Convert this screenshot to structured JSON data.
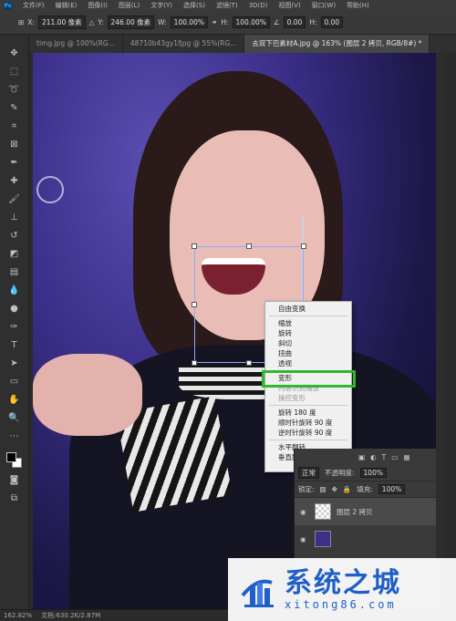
{
  "app": {
    "logo": "Ps"
  },
  "menu": [
    "文件(F)",
    "编辑(E)",
    "图像(I)",
    "图层(L)",
    "文字(Y)",
    "选择(S)",
    "滤镜(T)",
    "3D(D)",
    "视图(V)",
    "窗口(W)",
    "帮助(H)"
  ],
  "options": {
    "x_label": "X:",
    "x_value": "211.00 像素",
    "y_label": "Y:",
    "y_value": "246.00 像素",
    "w_label": "W:",
    "w_value": "100.00%",
    "h_label": "H:",
    "h_value": "100.00%",
    "angle_value": "0.00",
    "hskew_label": "H:",
    "hskew_value": "0.00"
  },
  "tabs": [
    {
      "label": "timg.jpg @ 100%(RG..."
    },
    {
      "label": "48710b43gy1fjpg @ 55%(RG..."
    },
    {
      "label": "去双下巴素材A.jpg @ 163% (图层 2 拷贝, RGB/8#) *"
    }
  ],
  "context_menu": {
    "items": [
      {
        "label": "自由变换",
        "disabled": false
      },
      {
        "sep": true
      },
      {
        "label": "缩放",
        "disabled": false
      },
      {
        "label": "旋转",
        "disabled": false
      },
      {
        "label": "斜切",
        "disabled": false
      },
      {
        "label": "扭曲",
        "disabled": false
      },
      {
        "label": "透视",
        "disabled": false
      },
      {
        "sep": true
      },
      {
        "label": "变形",
        "disabled": false
      },
      {
        "label": "内容识别缩放",
        "disabled": true
      },
      {
        "label": "操控变形",
        "disabled": true
      },
      {
        "sep": true
      },
      {
        "label": "旋转 180 度",
        "disabled": false
      },
      {
        "label": "顺时针旋转 90 度",
        "disabled": false
      },
      {
        "label": "逆时针旋转 90 度",
        "disabled": false
      },
      {
        "sep": true
      },
      {
        "label": "水平翻转",
        "disabled": false
      },
      {
        "label": "垂直翻转",
        "disabled": false
      }
    ],
    "highlight_color": "#2eb82e"
  },
  "layers_panel": {
    "blend_mode": "正常",
    "opacity_label": "不透明度:",
    "opacity_value": "100%",
    "lock_label": "锁定:",
    "fill_label": "填充:",
    "fill_value": "100%",
    "layer_name": "图层 2 拷贝"
  },
  "status": {
    "zoom": "162.82%",
    "doc": "文档:630.2K/2.87M"
  },
  "watermark": {
    "text": "系统之城",
    "url": "xitong86.com",
    "color": "#1f5fc8"
  }
}
